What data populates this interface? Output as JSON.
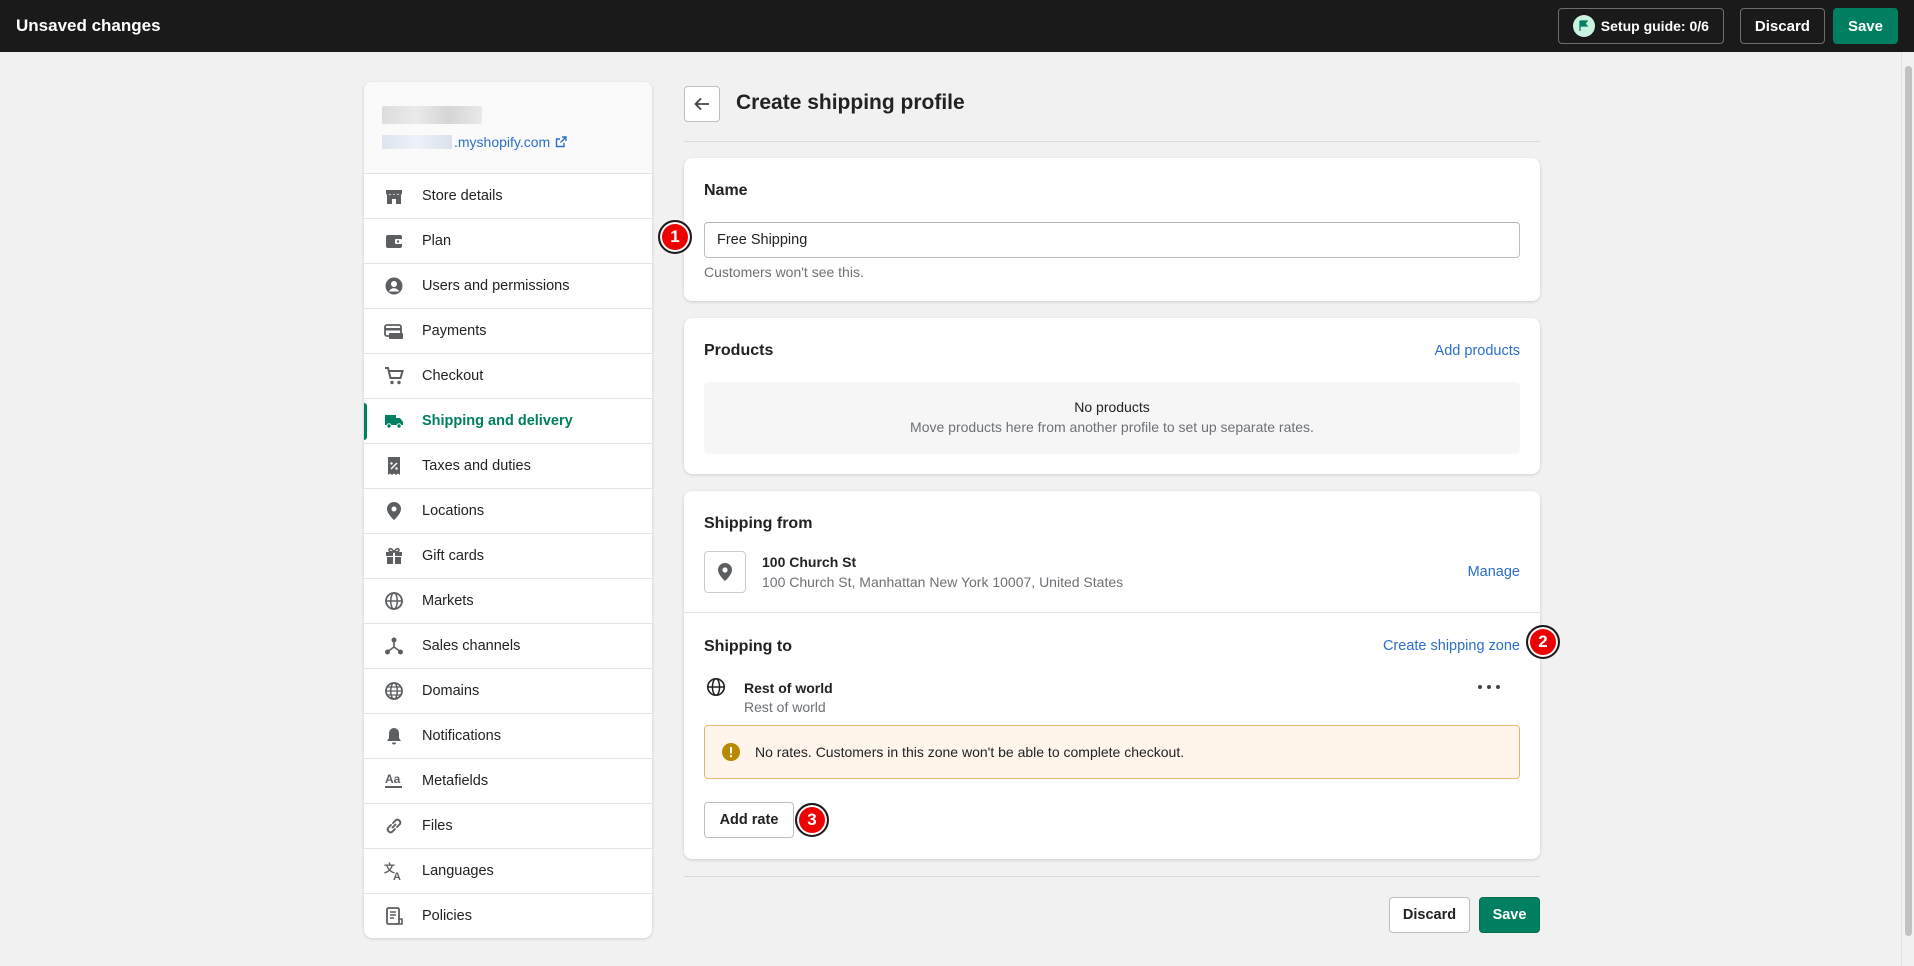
{
  "topbar": {
    "title": "Unsaved changes",
    "setup_guide": "Setup guide: 0/6",
    "discard": "Discard",
    "save": "Save"
  },
  "store": {
    "url_suffix": ".myshopify.com"
  },
  "sidebar": {
    "items": [
      {
        "label": "Store details",
        "icon": "store-icon"
      },
      {
        "label": "Plan",
        "icon": "plan-icon"
      },
      {
        "label": "Users and permissions",
        "icon": "user-icon"
      },
      {
        "label": "Payments",
        "icon": "payments-icon"
      },
      {
        "label": "Checkout",
        "icon": "cart-icon"
      },
      {
        "label": "Shipping and delivery",
        "icon": "truck-icon",
        "active": true
      },
      {
        "label": "Taxes and duties",
        "icon": "tax-icon"
      },
      {
        "label": "Locations",
        "icon": "location-icon"
      },
      {
        "label": "Gift cards",
        "icon": "gift-icon"
      },
      {
        "label": "Markets",
        "icon": "markets-icon"
      },
      {
        "label": "Sales channels",
        "icon": "channels-icon"
      },
      {
        "label": "Domains",
        "icon": "globe-icon"
      },
      {
        "label": "Notifications",
        "icon": "bell-icon"
      },
      {
        "label": "Metafields",
        "icon": "metafields-icon"
      },
      {
        "label": "Files",
        "icon": "link-icon"
      },
      {
        "label": "Languages",
        "icon": "language-icon"
      },
      {
        "label": "Policies",
        "icon": "policies-icon"
      }
    ]
  },
  "page": {
    "title": "Create shipping profile"
  },
  "name_card": {
    "title": "Name",
    "value": "Free Shipping",
    "help": "Customers won't see this."
  },
  "products_card": {
    "title": "Products",
    "add_link": "Add products",
    "empty_title": "No products",
    "empty_text": "Move products here from another profile to set up separate rates."
  },
  "shipping_card": {
    "from_title": "Shipping from",
    "location_name": "100 Church St",
    "location_address": "100 Church St, Manhattan New York 10007, United States",
    "manage": "Manage",
    "to_title": "Shipping to",
    "create_zone": "Create shipping zone",
    "zone_name": "Rest of world",
    "zone_sub": "Rest of world",
    "warning": "No rates. Customers in this zone won't be able to complete checkout.",
    "add_rate": "Add rate"
  },
  "footer": {
    "discard": "Discard",
    "save": "Save"
  },
  "annotations": [
    "1",
    "2",
    "3"
  ],
  "colors": {
    "accent": "#008060",
    "link": "#2c6ecb",
    "warning_bg": "#fff5ea",
    "warning_border": "#e1b878",
    "marker": "#ee0000"
  }
}
